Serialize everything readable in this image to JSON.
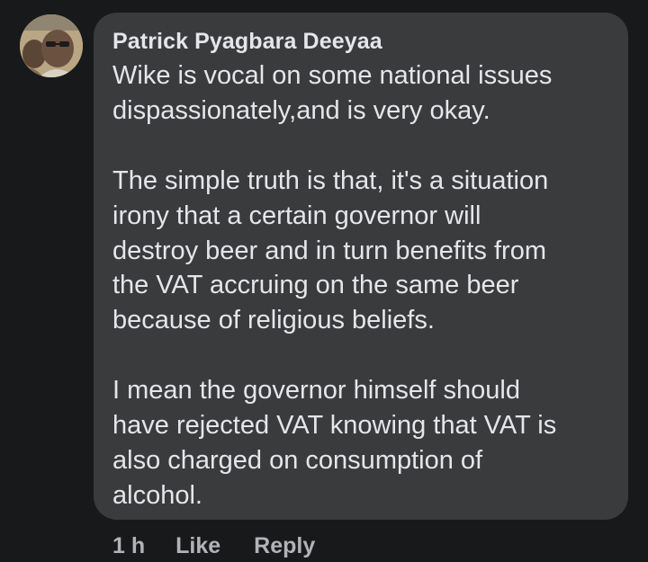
{
  "comment": {
    "author": "Patrick Pyagbara Deeyaa",
    "paragraphs": [
      {
        "lines": [
          "Wike is vocal on some national issues",
          "dispassionately,and is very okay."
        ]
      },
      {
        "lines": [
          "The simple truth is that, it's a situation",
          "irony that a certain governor will",
          "destroy beer and in turn benefits from",
          "the VAT accruing on the same beer",
          "because of religious beliefs."
        ]
      },
      {
        "lines": [
          "I mean the governor himself should",
          "have rejected VAT knowing that VAT is",
          "also charged on consumption of",
          "alcohol."
        ]
      }
    ],
    "timestamp": "1 h",
    "like_label": "Like",
    "reply_label": "Reply"
  },
  "avatar_icon": "profile-photo-icon",
  "colors": {
    "background": "#18191a",
    "bubble": "#3a3b3c",
    "text_primary": "#e4e6eb",
    "text_secondary": "#b0b3b8"
  }
}
